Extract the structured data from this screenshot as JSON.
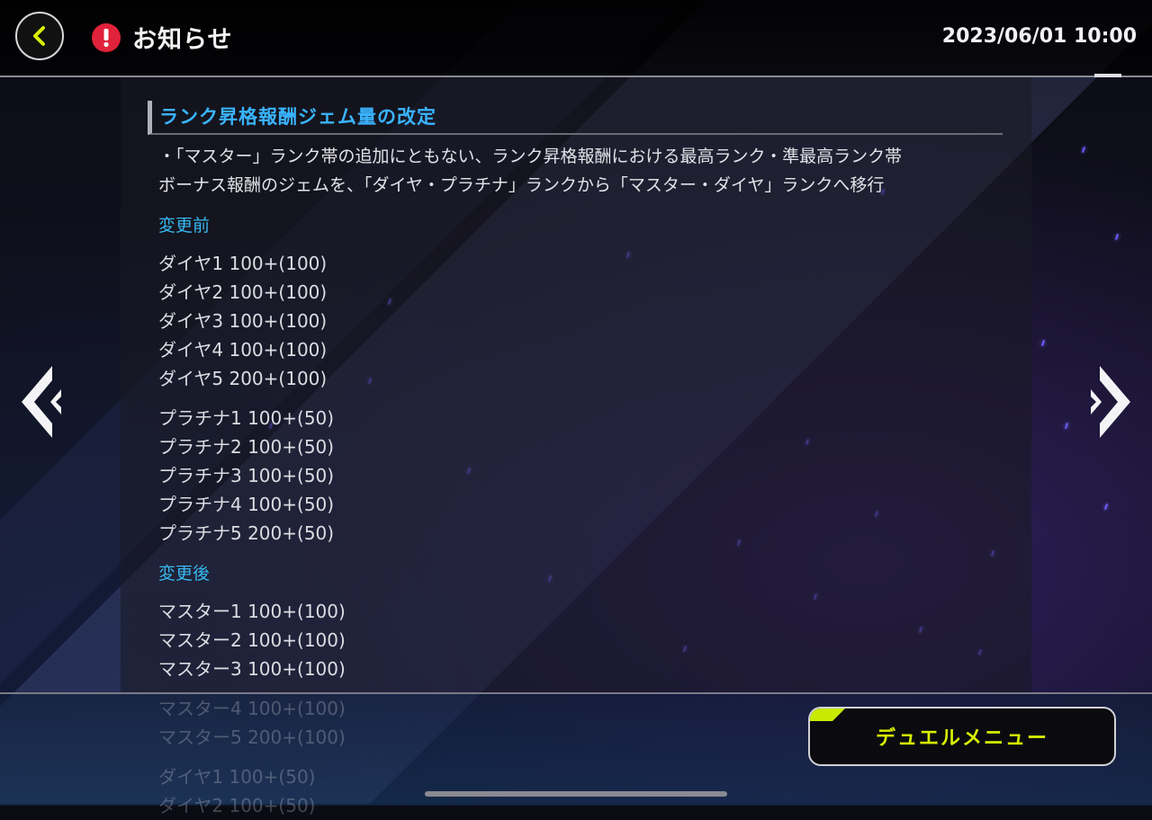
{
  "header": {
    "title": "お知らせ",
    "datetime": "2023/06/01 10:00"
  },
  "notice": {
    "section_title": "ランク昇格報酬ジェム量の改定",
    "description": [
      "・「マスター」ランク帯の追加にともない、ランク昇格報酬における最高ランク・準最高ランク帯",
      "ボーナス報酬のジェムを、「ダイヤ・プラチナ」ランクから「マスター・ダイヤ」ランクへ移行"
    ],
    "before_label": "変更前",
    "before_diamond": [
      "ダイヤ1 100+(100)",
      "ダイヤ2 100+(100)",
      "ダイヤ3 100+(100)",
      "ダイヤ4 100+(100)",
      "ダイヤ5 200+(100)"
    ],
    "before_platinum": [
      "プラチナ1 100+(50)",
      "プラチナ2 100+(50)",
      "プラチナ3 100+(50)",
      "プラチナ4 100+(50)",
      "プラチナ5 200+(50)"
    ],
    "after_label": "変更後",
    "after_master": [
      "マスター1 100+(100)",
      "マスター2 100+(100)",
      "マスター3 100+(100)"
    ],
    "after_faded": [
      "マスター4 100+(100)",
      "マスター5 200+(100)",
      "",
      "ダイヤ1 100+(50)",
      "ダイヤ2 100+(50)"
    ]
  },
  "footer": {
    "duel_menu_label": "デュエルメニュー"
  },
  "icons": {
    "back": "chevron-left-icon",
    "alert": "exclamation-icon",
    "prev": "double-chevron-left-icon",
    "next": "double-chevron-right-icon"
  },
  "colors": {
    "accent_yellow": "#d8f000",
    "heading_blue": "#3ab4ff",
    "alert_red": "#e0223a"
  }
}
